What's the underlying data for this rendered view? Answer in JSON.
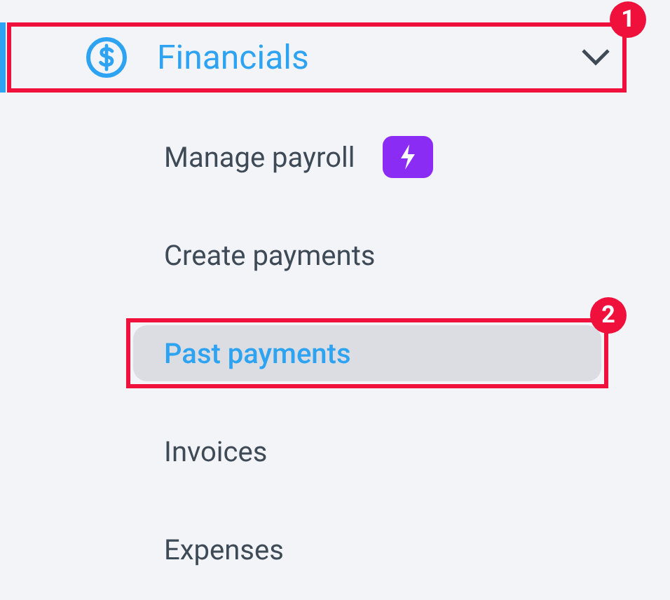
{
  "section": {
    "label": "Financials",
    "expanded": true,
    "callout": "1"
  },
  "items": [
    {
      "label": "Manage payroll",
      "selected": false,
      "flash_badge": true
    },
    {
      "label": "Create payments",
      "selected": false,
      "flash_badge": false
    },
    {
      "label": "Past payments",
      "selected": true,
      "flash_badge": false,
      "callout": "2"
    },
    {
      "label": "Invoices",
      "selected": false,
      "flash_badge": false
    },
    {
      "label": "Expenses",
      "selected": false,
      "flash_badge": false
    }
  ]
}
